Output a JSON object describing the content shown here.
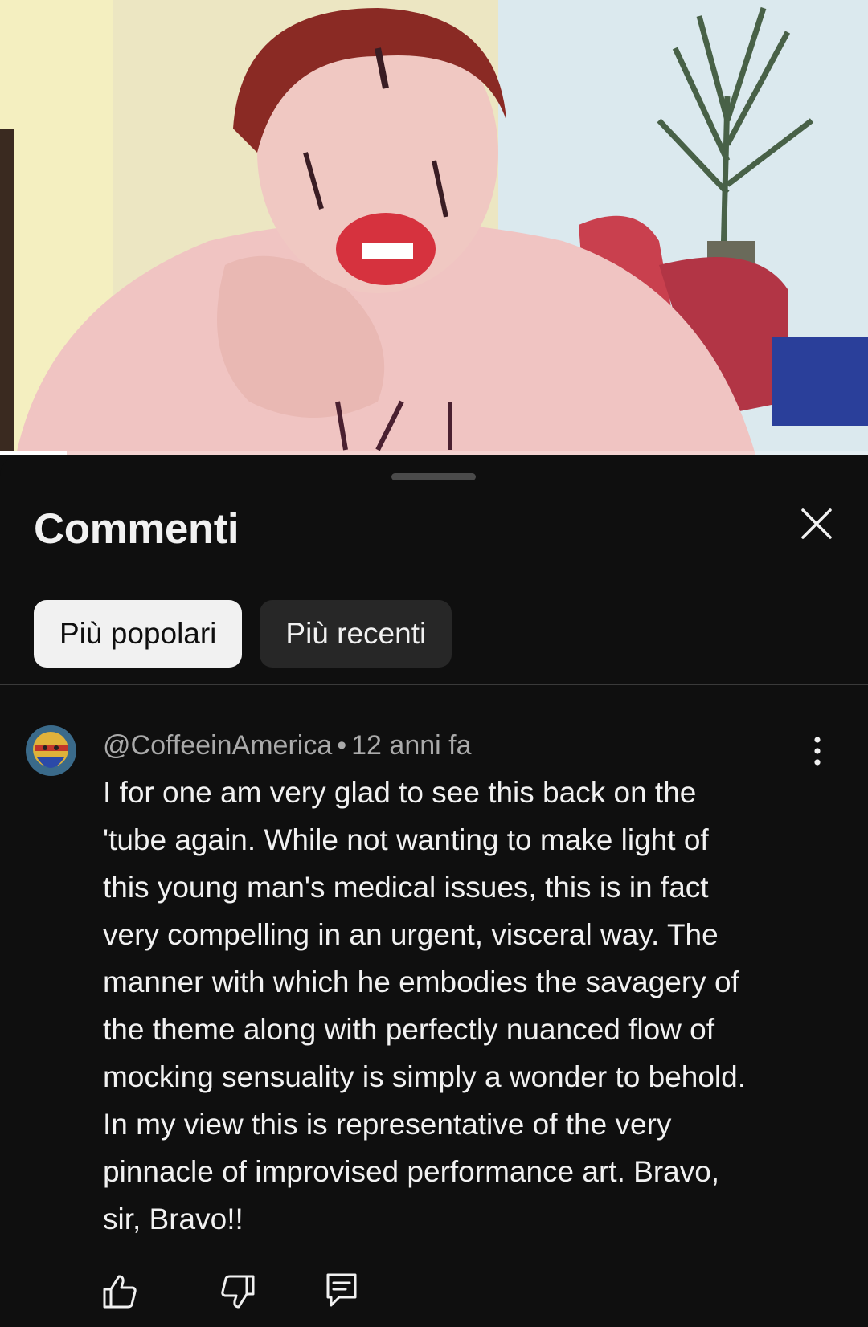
{
  "video": {
    "progress_fraction": 0.077
  },
  "sheet": {
    "title": "Commenti",
    "close_icon": "close-icon",
    "sort_chips": [
      {
        "label": "Più popolari",
        "selected": true
      },
      {
        "label": "Più recenti",
        "selected": false
      }
    ]
  },
  "comment": {
    "author": "@CoffeeinAmerica",
    "separator": "•",
    "time": "12 anni fa",
    "text": "I for one am very glad to see this back on the\n'tube again. While not wanting to make light of\nthis young man's medical issues, this is in fact\nvery compelling in an urgent, visceral way. The\nmanner with which he embodies the savagery of\nthe theme along with perfectly nuanced flow of\nmocking sensuality is simply a wonder to behold.\nIn my view this is representative of the very\npinnacle of improvised performance art. Bravo,\nsir, Bravo!!",
    "menu_icon": "more-vertical-icon",
    "actions": [
      "like-icon",
      "dislike-icon",
      "reply-icon"
    ]
  },
  "colors": {
    "background": "#0f0f0f",
    "chip_active_bg": "#f1f1f1",
    "chip_inactive_bg": "#272727",
    "secondary_text": "#aaaaaa"
  }
}
